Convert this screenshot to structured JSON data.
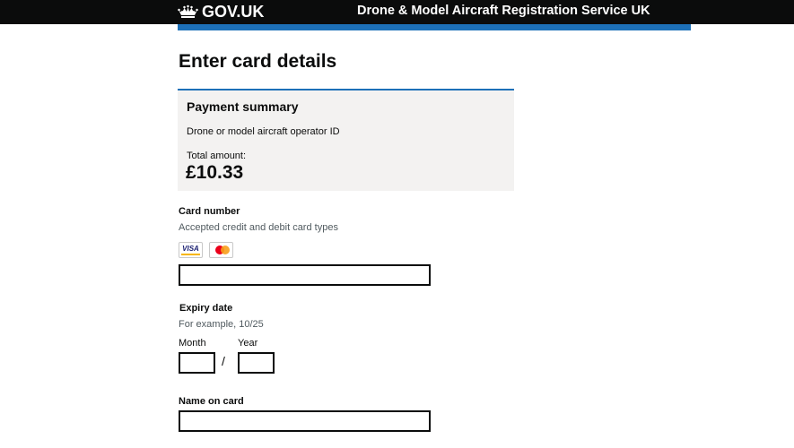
{
  "header": {
    "logo_text": "GOV.UK",
    "service_name": "Drone & Model Aircraft Registration Service UK"
  },
  "page": {
    "title": "Enter card details"
  },
  "payment_summary": {
    "heading": "Payment summary",
    "description": "Drone or model aircraft operator ID",
    "total_label": "Total amount:",
    "amount": "£10.33"
  },
  "card_number": {
    "label": "Card number",
    "hint": "Accepted credit and debit card types",
    "value": "",
    "accepted_cards": [
      {
        "name": "visa-icon",
        "text": "VISA"
      },
      {
        "name": "mastercard-icon",
        "text": "mastercard"
      }
    ]
  },
  "expiry": {
    "label": "Expiry date",
    "hint": "For example, 10/25",
    "month_label": "Month",
    "year_label": "Year",
    "month_value": "",
    "year_value": "",
    "separator": "/"
  },
  "name_on_card": {
    "label": "Name on card",
    "value": ""
  },
  "colors": {
    "header_bg": "#0b0c0c",
    "accent_blue": "#1d70b8",
    "summary_bg": "#f3f2f1",
    "hint_text": "#505a5f"
  }
}
